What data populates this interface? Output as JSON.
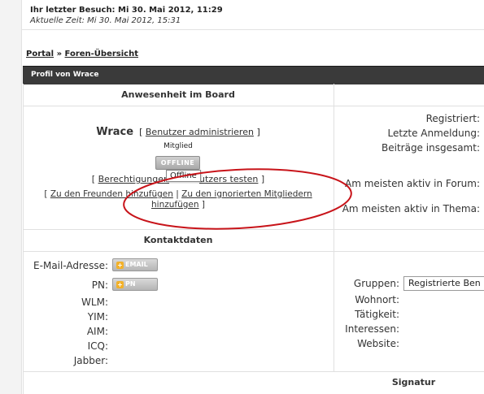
{
  "header": {
    "last_visit": "Ihr letzter Besuch: Mi 30. Mai 2012, 11:29",
    "current_time": "Aktuelle Zeit: Mi 30. Mai 2012, 15:31"
  },
  "breadcrumb": {
    "portal": "Portal",
    "separator": "»",
    "forum_index": "Foren-Übersicht"
  },
  "profile": {
    "bar_title": "Profil von Wrace",
    "presence_heading": "Anwesenheit im Board",
    "username": "Wrace",
    "admin_bracket_open": "[",
    "admin_link": "Benutzer administrieren",
    "admin_bracket_close": "]",
    "rank": "Mitglied",
    "status_button": "OFFLINE",
    "status_tooltip": "Offline",
    "perm_bracket_open": "[",
    "permissions_link_start": "Berechtigungen",
    "permissions_link_end": "utzers testen",
    "perm_bracket_close": "]",
    "friend_bracket_open": "[",
    "add_friend_link": "Zu den Freunden hinzufügen",
    "pipe": "|",
    "ignore_link_1": "Zu den ignorierten Mitgliedern",
    "ignore_link_2": "hinzufügen",
    "friend_bracket_close": "]"
  },
  "stats": {
    "registered": "Registriert:",
    "last_login": "Letzte Anmeldung:",
    "total_posts": "Beiträge insgesamt:",
    "most_active_forum": "Am meisten aktiv in Forum:",
    "most_active_topic": "Am meisten aktiv in Thema:"
  },
  "contact": {
    "heading": "Kontaktdaten",
    "email_label": "E-Mail-Adresse:",
    "email_button": "EMAIL",
    "pm_label": "PN:",
    "pm_button": "PN",
    "wlm_label": "WLM:",
    "yim_label": "YIM:",
    "aim_label": "AIM:",
    "icq_label": "ICQ:",
    "jabber_label": "Jabber:"
  },
  "info": {
    "groups_label": "Gruppen:",
    "groups_value": "Registrierte Ben",
    "location_label": "Wohnort:",
    "occupation_label": "Tätigkeit:",
    "interests_label": "Interessen:",
    "website_label": "Website:"
  },
  "signature": {
    "heading": "Signatur"
  },
  "colors": {
    "bar": "#3a3a3a",
    "annotation_circle": "#c8141a",
    "button_plus": "#f2b12a"
  }
}
